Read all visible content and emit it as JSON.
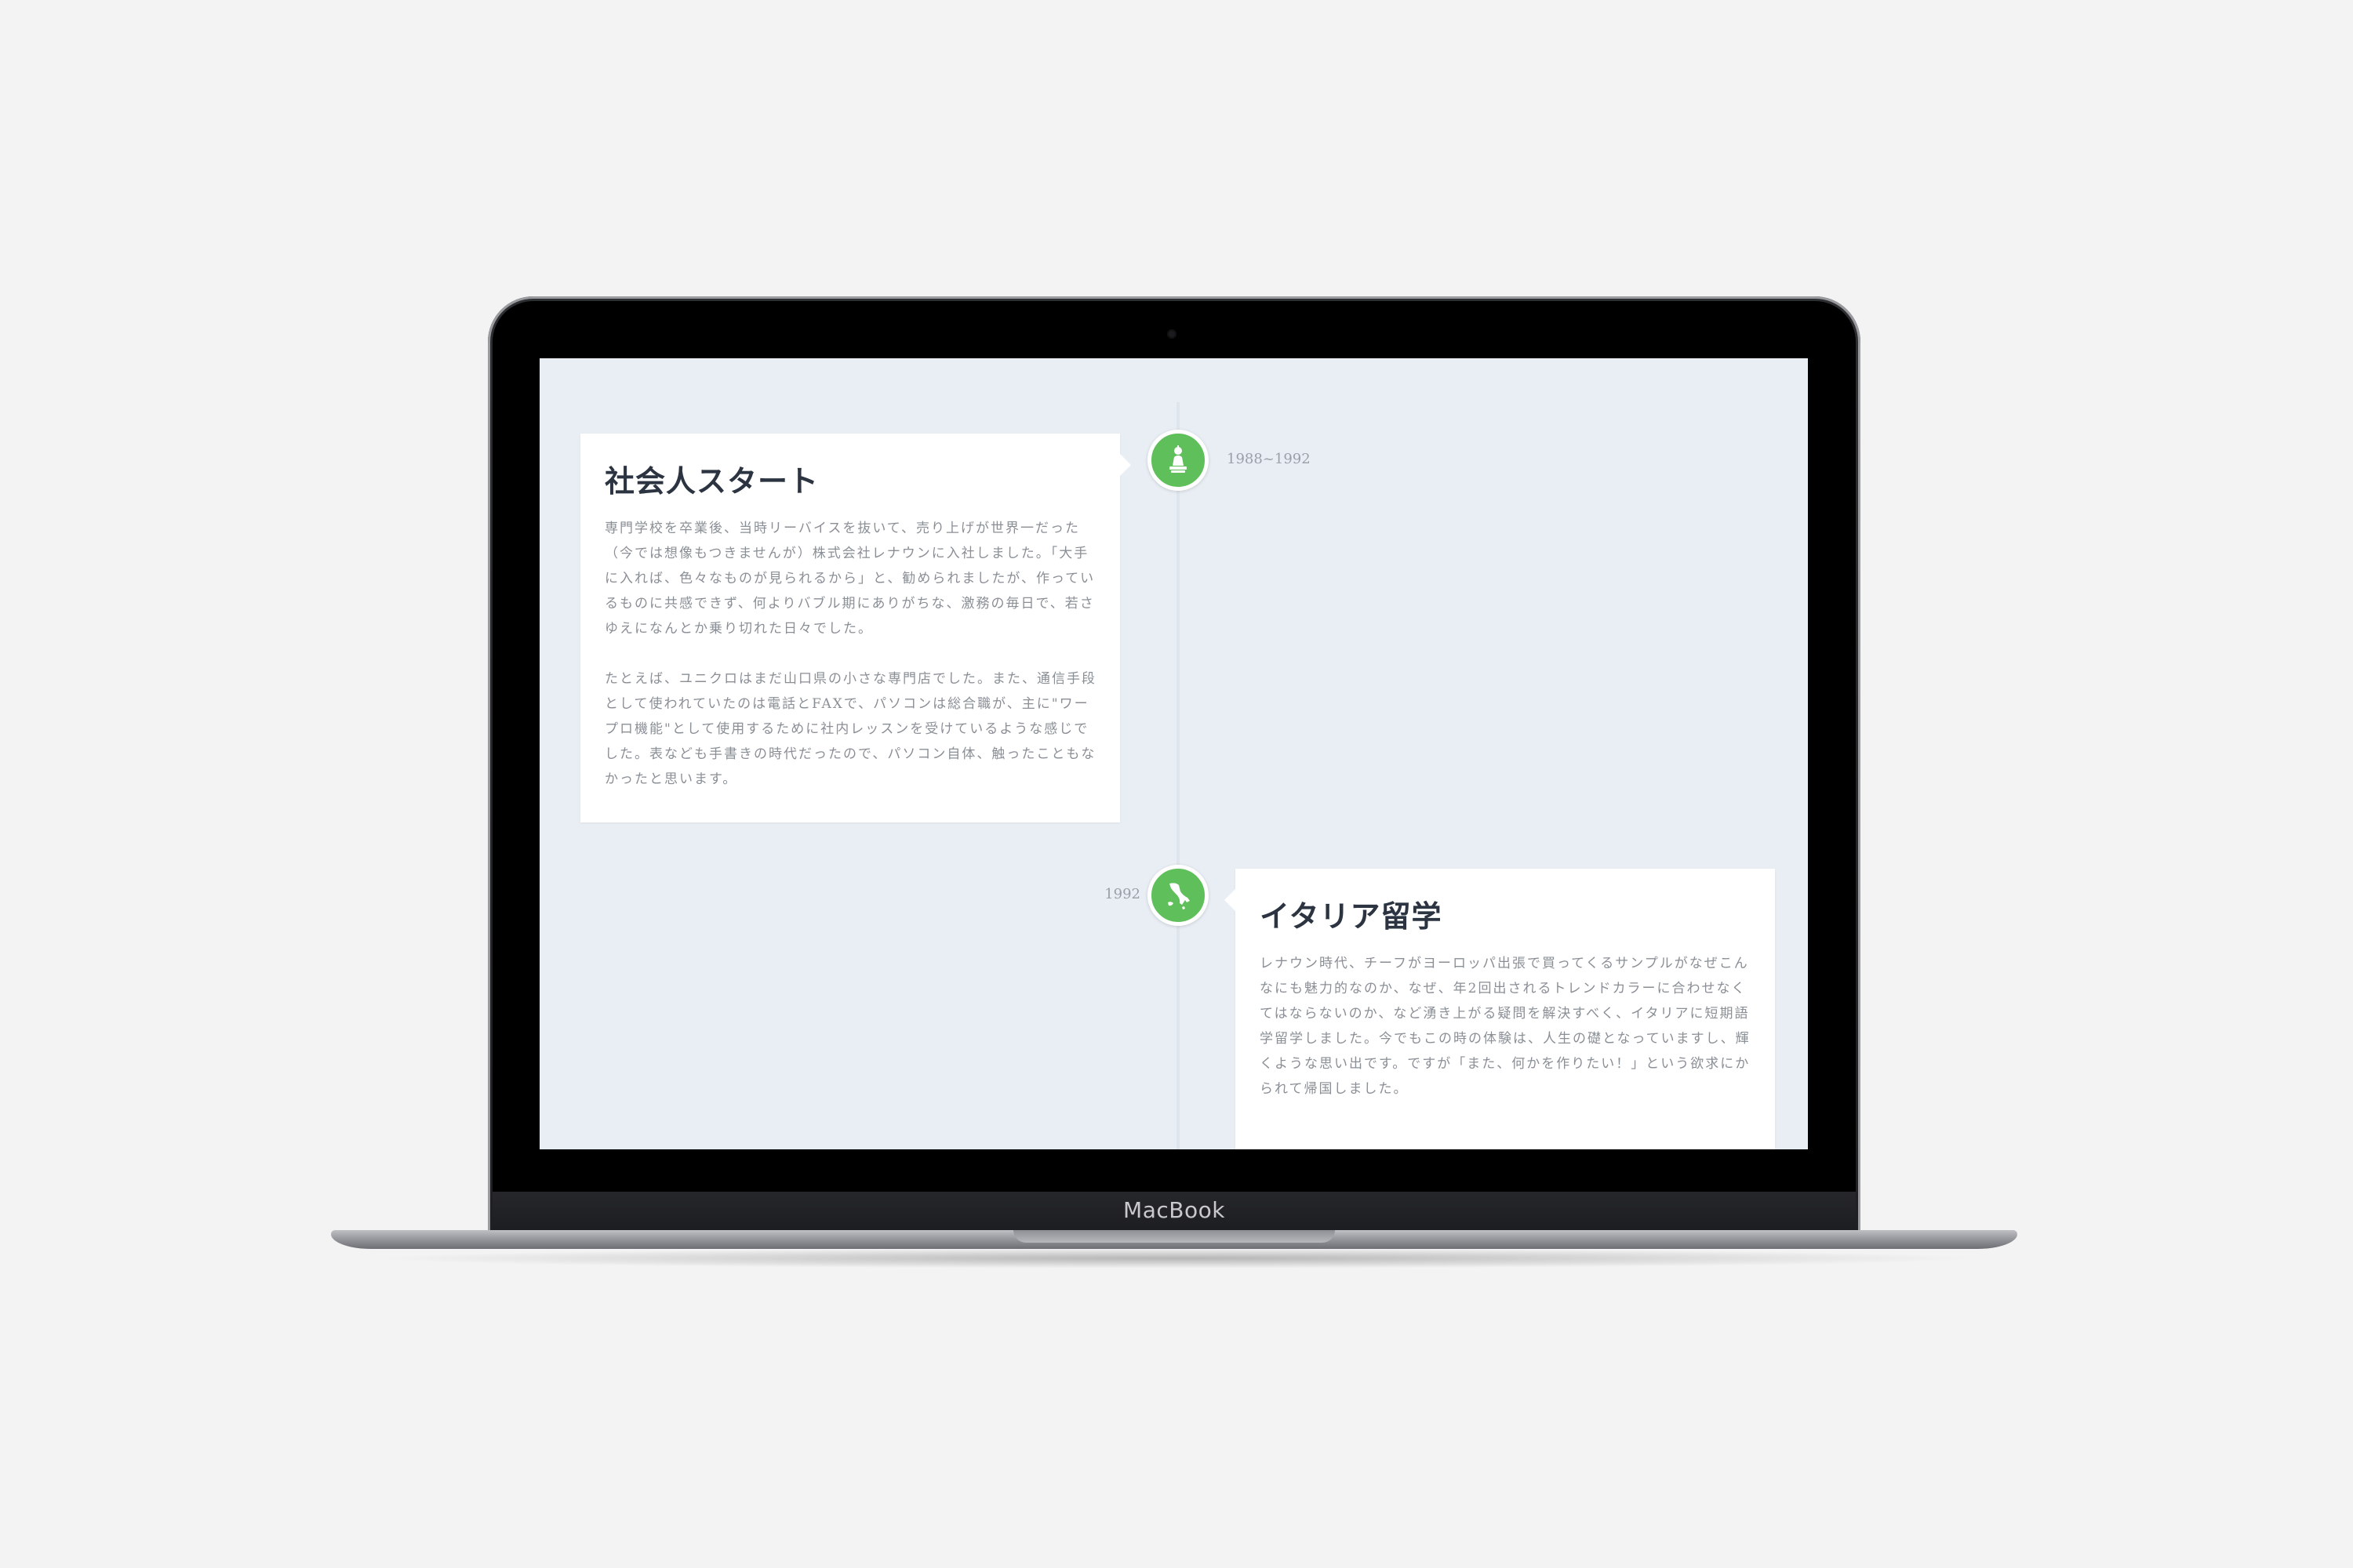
{
  "device": {
    "brand": "MacBook"
  },
  "timeline": {
    "accent_color": "#5fbf5a",
    "entries": [
      {
        "date": "1988~1992",
        "title": "社会人スタート",
        "icon": "person-statue-icon",
        "paragraphs": [
          "専門学校を卒業後、当時リーバイスを抜いて、売り上げが世界一だった（今では想像もつきませんが）株式会社レナウンに入社しました。「大手に入れば、色々なものが見られるから」と、勧められましたが、作っているものに共感できず、何よりバブル期にありがちな、激務の毎日で、若さゆえになんとか乗り切れた日々でした。",
          "たとえば、ユニクロはまだ山口県の小さな専門店でした。また、通信手段として使われていたのは電話とFAXで、パソコンは総合職が、主に\"ワープロ機能\"として使用するために社内レッスンを受けているような感じでした。表なども手書きの時代だったので、パソコン自体、触ったこともなかったと思います。"
        ]
      },
      {
        "date": "1992",
        "title": "イタリア留学",
        "icon": "italy-map-icon",
        "paragraphs": [
          "レナウン時代、チーフがヨーロッパ出張で買ってくるサンプルがなぜこんなにも魅力的なのか、なぜ、年2回出されるトレンドカラーに合わせなくてはならないのか、など湧き上がる疑問を解決すべく、イタリアに短期語学留学しました。今でもこの時の体験は、人生の礎となっていますし、輝くような思い出です。ですが「また、何かを作りたい！」という欲求にかられて帰国しました。"
        ]
      }
    ]
  }
}
